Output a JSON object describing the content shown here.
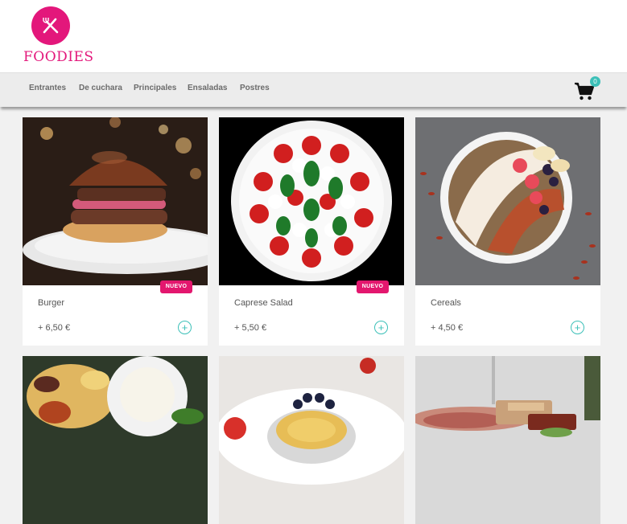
{
  "brand": {
    "name": "FOODIES",
    "icon": "fork-knife-icon",
    "color": "#e3177b"
  },
  "nav": {
    "items": [
      "Entrantes",
      "De cuchara",
      "Principales",
      "Ensaladas",
      "Postres"
    ]
  },
  "cart": {
    "icon": "shopping-cart-icon",
    "count": "0",
    "badge_color": "#3cc0b8"
  },
  "products": [
    {
      "name": "Burger",
      "price": "+ 6,50 €",
      "badge": "NUEVO",
      "image": "burger-photo"
    },
    {
      "name": "Caprese Salad",
      "price": "+ 5,50 €",
      "badge": "NUEVO",
      "image": "caprese-salad-photo"
    },
    {
      "name": "Cereals",
      "price": "+ 4,50 €",
      "badge": "",
      "image": "cereal-bowl-photo"
    },
    {
      "name": "",
      "price": "",
      "badge": "",
      "image": "dip-platter-photo"
    },
    {
      "name": "",
      "price": "",
      "badge": "",
      "image": "creme-brulee-photo"
    },
    {
      "name": "",
      "price": "",
      "badge": "",
      "image": "charcuterie-photo"
    }
  ],
  "add_symbol": "+"
}
